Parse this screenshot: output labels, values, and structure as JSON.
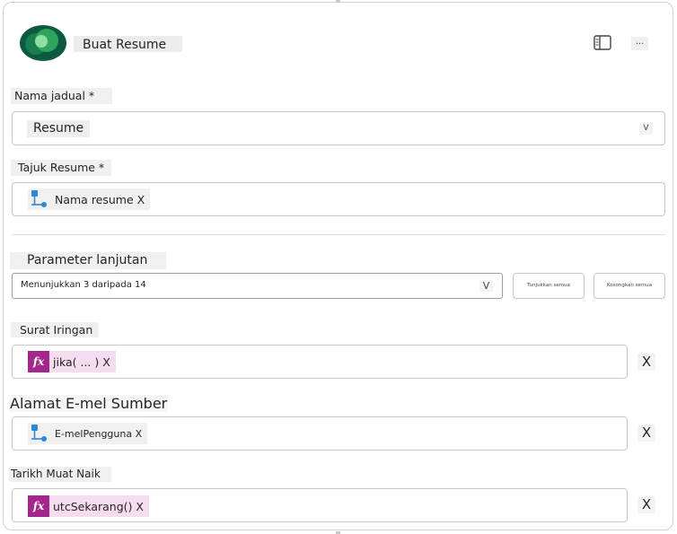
{
  "header": {
    "title": "Buat Resume",
    "panel_icon": "side-panel-icon",
    "more_label": "..."
  },
  "table_name": {
    "label": "Nama jadual *",
    "value": "Resume",
    "chevron": "V"
  },
  "resume_title": {
    "label": "Tajuk Resume *",
    "token": "Nama resume X"
  },
  "advanced": {
    "label": "Parameter lanjutan",
    "selected": "Menunjukkan 3 daripada 14",
    "chevron": "V",
    "show_all_button": "Tunjukkan semua",
    "clear_all_button": "Kosongkan semua"
  },
  "fields": [
    {
      "label": "Surat Iringan",
      "token_type": "fx",
      "fx_label": "fx",
      "token": "jika( ... ) X",
      "remove": "X"
    },
    {
      "label": "Alamat E-mel Sumber",
      "token_type": "flow",
      "token": "E-melPengguna X",
      "remove": "X"
    },
    {
      "label": "Tarikh Muat Naik",
      "token_type": "fx",
      "fx_label": "fx",
      "token": "utcSekarang() X",
      "remove": "X"
    }
  ],
  "colors": {
    "fx_accent": "#a4278c",
    "logo_dark": "#0b5a3f",
    "logo_light": "#3fc36b",
    "flow_icon": "#2b88d8"
  }
}
